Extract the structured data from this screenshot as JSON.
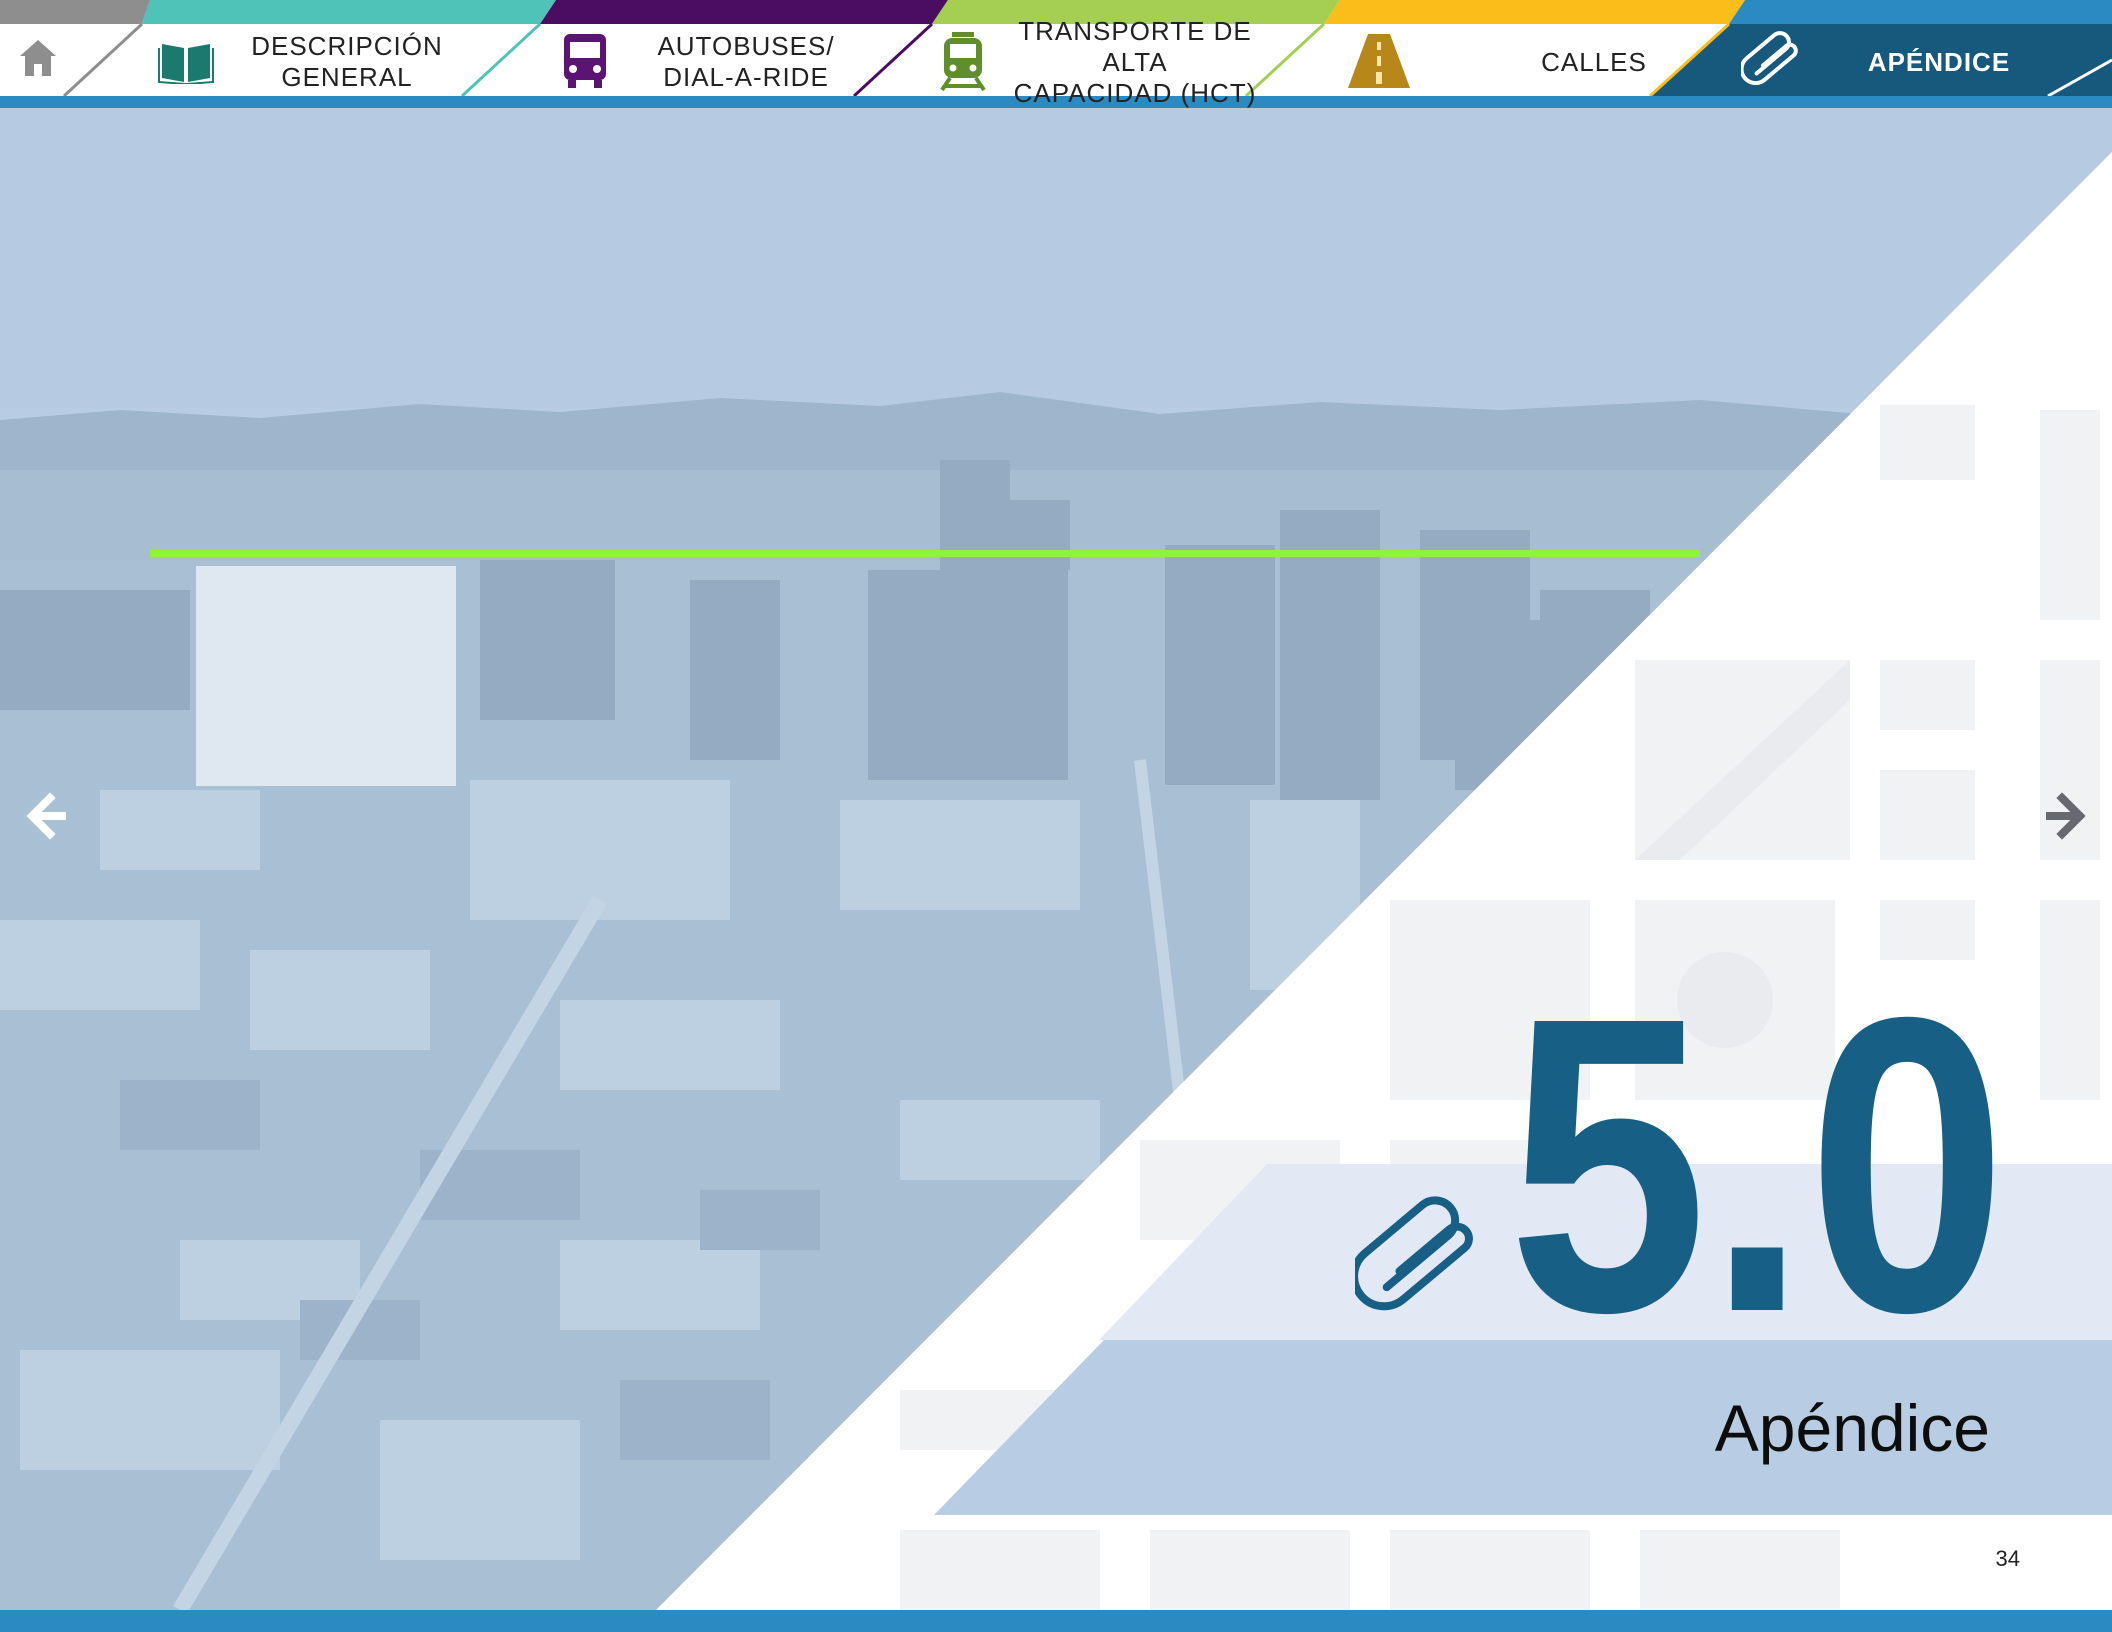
{
  "nav": {
    "home_icon": "home-icon",
    "tabs": [
      {
        "label": "DESCRIPCIÓN\nGENERAL",
        "icon": "open-book-icon",
        "color": "#4fc3b8",
        "icon_color": "#1b7a6e"
      },
      {
        "label": "AUTOBUSES/\nDIAL-A-RIDE",
        "icon": "bus-icon",
        "color": "#4a0d62",
        "icon_color": "#5b1474"
      },
      {
        "label": "TRANSPORTE DE ALTA\nCAPACIDAD (HCT)",
        "icon": "train-icon",
        "color": "#a5cf52",
        "icon_color": "#5f8f2a"
      },
      {
        "label": "CALLES",
        "icon": "road-icon",
        "color": "#fbbd19",
        "icon_color": "#b8871a"
      },
      {
        "label": "APÉNDICE",
        "icon": "paperclip-icon",
        "color": "#2b8ac2",
        "icon_color": "#ffffff",
        "active": true,
        "active_bg": "#17587d"
      }
    ]
  },
  "hero": {
    "image": "aerial-city-skyline-photo",
    "prev_icon": "arrow-left-icon",
    "next_icon": "arrow-right-icon"
  },
  "chapter": {
    "number": "5.0",
    "title": "Apéndice",
    "icon": "paperclip-icon",
    "color": "#175f85"
  },
  "page_number": "34",
  "colors": {
    "bottom_bar": "#2b8ac2",
    "photo_tint": "#b8cde3",
    "band_light": "#e3e9f4",
    "band_mid": "#b8cde3"
  }
}
